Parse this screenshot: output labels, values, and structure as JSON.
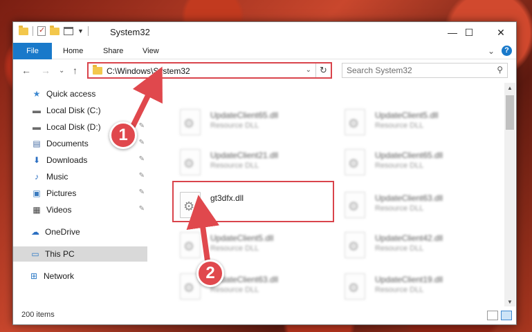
{
  "window": {
    "title": "System32",
    "controls": {
      "minimize": "—",
      "maximize": "☐",
      "close": "✕"
    }
  },
  "ribbon": {
    "tabs": [
      {
        "label": "File",
        "active": true
      },
      {
        "label": "Home"
      },
      {
        "label": "Share"
      },
      {
        "label": "View"
      }
    ],
    "expand": "⌄",
    "help": "?"
  },
  "nav": {
    "back": "←",
    "forward": "→",
    "recent": "⌄",
    "up": "↑",
    "address": "C:\\Windows\\System32",
    "address_dropdown": "⌄",
    "refresh": "↻",
    "search_placeholder": "Search System32",
    "search_icon": "search-icon"
  },
  "sidebar": {
    "items": [
      {
        "label": "Quick access",
        "icon": "star-icon",
        "glyph": "★",
        "color": "#3c88d0",
        "pinned": false
      },
      {
        "label": "Local Disk (C:)",
        "icon": "drive-icon",
        "glyph": "▬",
        "color": "#6b6b6b",
        "pinned": true
      },
      {
        "label": "Local Disk (D:)",
        "icon": "drive-icon",
        "glyph": "▬",
        "color": "#6b6b6b",
        "pinned": true
      },
      {
        "label": "Documents",
        "icon": "documents-icon",
        "glyph": "▤",
        "color": "#4a6fa5",
        "pinned": true
      },
      {
        "label": "Downloads",
        "icon": "download-icon",
        "glyph": "⬇",
        "color": "#2b6fc2",
        "pinned": true
      },
      {
        "label": "Music",
        "icon": "music-icon",
        "glyph": "♪",
        "color": "#2b6fc2",
        "pinned": true
      },
      {
        "label": "Pictures",
        "icon": "pictures-icon",
        "glyph": "▣",
        "color": "#3a7bbf",
        "pinned": true
      },
      {
        "label": "Videos",
        "icon": "videos-icon",
        "glyph": "▦",
        "color": "#444444",
        "pinned": true
      },
      {
        "label": "OneDrive",
        "icon": "cloud-icon",
        "glyph": "☁",
        "color": "#2b6fc2",
        "pinned": false
      },
      {
        "label": "This PC",
        "icon": "computer-icon",
        "glyph": "▭",
        "color": "#2b78c5",
        "pinned": false,
        "selected": true
      },
      {
        "label": "Network",
        "icon": "network-icon",
        "glyph": "⊞",
        "color": "#2b78c5",
        "pinned": false
      }
    ],
    "pin_glyph": "📌"
  },
  "files": {
    "left_column": [
      {
        "name": "UpdateClient65.dll",
        "type": "Resource DLL",
        "blurred": true
      },
      {
        "name": "UpdateClient21.dll",
        "type": "Resource DLL",
        "blurred": true
      },
      {
        "name": "gt3dfx.dll",
        "type": "",
        "blurred": false,
        "highlighted": true
      },
      {
        "name": "UpdateClient5.dll",
        "type": "Resource DLL",
        "blurred": true
      },
      {
        "name": "UpdateClient63.dll",
        "type": "Resource DLL",
        "blurred": true
      }
    ],
    "right_column": [
      {
        "name": "UpdateClient5.dll",
        "type": "Resource DLL",
        "blurred": true
      },
      {
        "name": "UpdateClient65.dll",
        "type": "Resource DLL",
        "blurred": true
      },
      {
        "name": "UpdateClient63.dll",
        "type": "Resource DLL",
        "blurred": true
      },
      {
        "name": "UpdateClient42.dll",
        "type": "Resource DLL",
        "blurred": true
      },
      {
        "name": "UpdateClient19.dll",
        "type": "Resource DLL",
        "blurred": true
      }
    ]
  },
  "status": {
    "item_count": "200 items"
  },
  "callouts": [
    {
      "label": "1",
      "color": "#e0484d"
    },
    {
      "label": "2",
      "color": "#e0484d"
    }
  ]
}
